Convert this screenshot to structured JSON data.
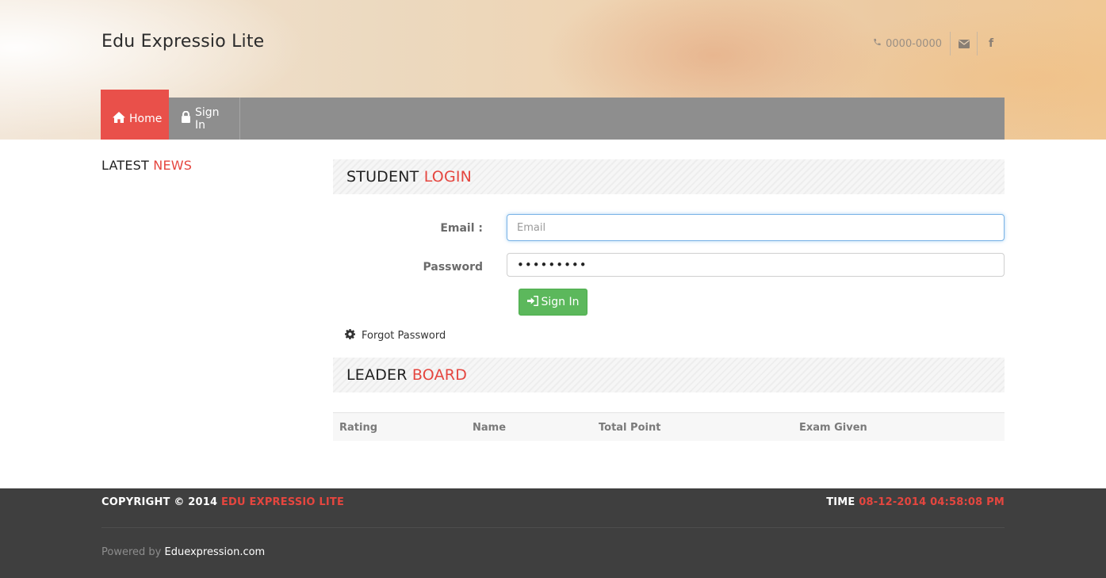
{
  "header": {
    "site_title": "Edu Expressio Lite",
    "phone": "0000-0000",
    "phone_icon": "phone-icon",
    "mail_icon": "envelope-icon",
    "facebook_icon": "facebook-icon",
    "facebook_glyph": "f"
  },
  "nav": {
    "items": [
      {
        "label": "Home",
        "icon": "home-icon",
        "active": true
      },
      {
        "label": "Sign In",
        "icon": "lock-icon",
        "active": false
      }
    ]
  },
  "sidebar": {
    "title_part1": "LATEST",
    "title_part2": "NEWS"
  },
  "login": {
    "title_part1": "STUDENT",
    "title_part2": "LOGIN",
    "email_label": "Email :",
    "email_placeholder": "Email",
    "email_value": "",
    "password_label": "Password",
    "password_value": "•••••••••",
    "submit_label": "Sign In",
    "submit_icon": "sign-in-icon",
    "forgot_label": "Forgot Password",
    "forgot_icon": "gear-icon"
  },
  "leaderboard": {
    "title_part1": "LEADER",
    "title_part2": "BOARD",
    "columns": [
      "Rating",
      "Name",
      "Total Point",
      "Exam Given"
    ],
    "rows": []
  },
  "footer": {
    "copyright_prefix": "COPYRIGHT © 2014",
    "copyright_brand": "EDU EXPRESSIO LITE",
    "time_label": "TIME",
    "time_value": "08-12-2014 04:58:08 PM",
    "powered_prefix": "Powered by",
    "powered_link": "Eduexpression.com"
  },
  "colors": {
    "accent": "#e9504a",
    "nav_bg": "#8e8e8e",
    "success": "#5cb85c",
    "footer_bg": "#3f3f3f"
  }
}
